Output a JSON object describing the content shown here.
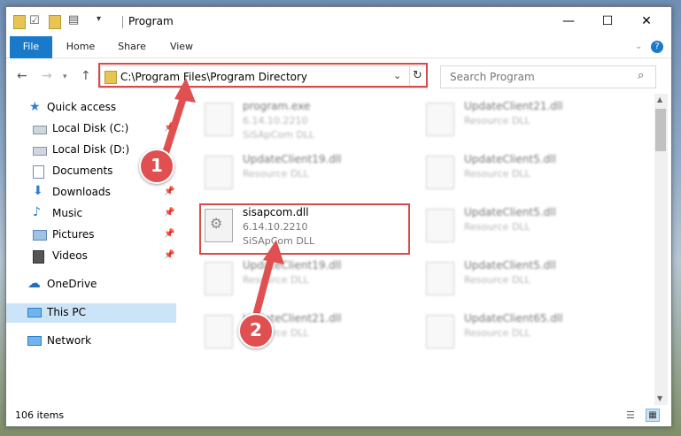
{
  "title": "Program",
  "ribbon": {
    "tabs": [
      "File",
      "Home",
      "Share",
      "View"
    ]
  },
  "address": {
    "path": "C:\\Program Files\\Program Directory"
  },
  "search": {
    "placeholder": "Search Program"
  },
  "sidebar": {
    "items": [
      {
        "label": "Quick access",
        "icon": "star-icon"
      },
      {
        "label": "Local Disk (C:)",
        "icon": "drive-icon"
      },
      {
        "label": "Local Disk (D:)",
        "icon": "drive-icon"
      },
      {
        "label": "Documents",
        "icon": "documents-icon"
      },
      {
        "label": "Downloads",
        "icon": "download-icon"
      },
      {
        "label": "Music",
        "icon": "music-icon"
      },
      {
        "label": "Pictures",
        "icon": "pictures-icon"
      },
      {
        "label": "Videos",
        "icon": "videos-icon"
      },
      {
        "label": "OneDrive",
        "icon": "cloud-icon"
      },
      {
        "label": "This PC",
        "icon": "pc-icon"
      },
      {
        "label": "Network",
        "icon": "network-icon"
      }
    ]
  },
  "files": [
    {
      "name": "program.exe",
      "line1": "6.14.10.2210",
      "line2": "SiSApCom DLL"
    },
    {
      "name": "UpdateClient21.dll",
      "line1": "Resource DLL",
      "line2": ""
    },
    {
      "name": "UpdateClient19.dll",
      "line1": "Resource DLL",
      "line2": ""
    },
    {
      "name": "UpdateClient5.dll",
      "line1": "Resource DLL",
      "line2": ""
    },
    {
      "name": "sisapcom.dll",
      "line1": "6.14.10.2210",
      "line2": "SiSApCom DLL"
    },
    {
      "name": "UpdateClient5.dll",
      "line1": "Resource DLL",
      "line2": ""
    },
    {
      "name": "UpdateClient19.dll",
      "line1": "Resource DLL",
      "line2": ""
    },
    {
      "name": "UpdateClient5.dll",
      "line1": "Resource DLL",
      "line2": ""
    },
    {
      "name": "UpdateClient21.dll",
      "line1": "Resource DLL",
      "line2": ""
    },
    {
      "name": "UpdateClient65.dll",
      "line1": "Resource DLL",
      "line2": ""
    }
  ],
  "badges": {
    "one": "1",
    "two": "2"
  },
  "status": {
    "items": "106 items"
  },
  "colors": {
    "accent": "#1979ca",
    "highlight": "#d94a4a"
  }
}
